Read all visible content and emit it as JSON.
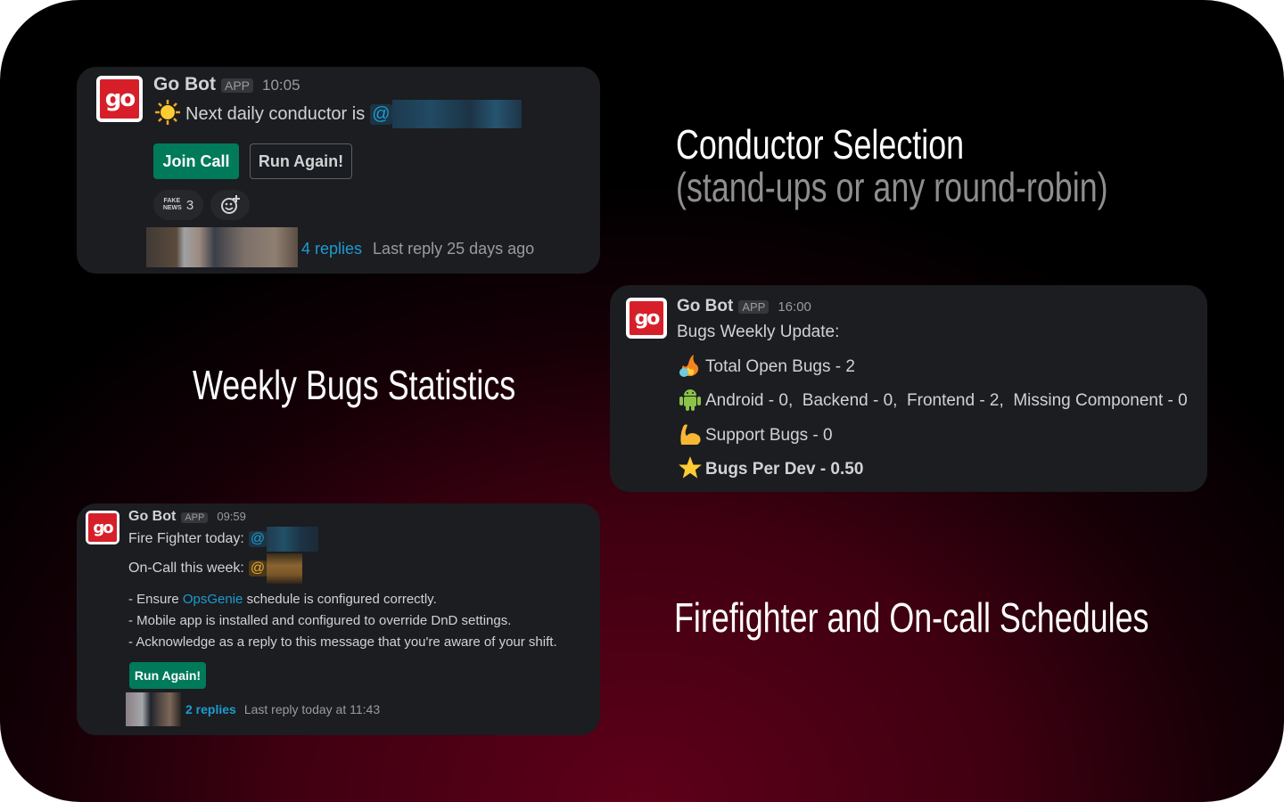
{
  "colors": {
    "accent_green": "#007a5a",
    "link_blue": "#1d9bd1",
    "card_bg": "#1b1d21",
    "brand_red": "#d71f2a"
  },
  "headings": {
    "conductor_title": "Conductor Selection",
    "conductor_subtitle": "(stand-ups or any round-robin)",
    "bugs_title": "Weekly Bugs Statistics",
    "firefighter_title": "Firefighter and On-call Schedules"
  },
  "msg1": {
    "avatar_text": "go",
    "bot_name": "Go Bot",
    "app_badge": "APP",
    "time": "10:05",
    "emoji_icon": "sun-icon",
    "text": "Next daily conductor is",
    "mention": "@",
    "join_call_label": "Join Call",
    "run_again_label": "Run Again!",
    "reaction_emoji": "FAKE NEWS",
    "reaction_count": "3",
    "add_reaction_icon": "add-reaction-icon",
    "replies_label": "4 replies",
    "last_reply": "Last reply 25 days ago"
  },
  "msg2": {
    "avatar_text": "go",
    "bot_name": "Go Bot",
    "app_badge": "APP",
    "time": "16:00",
    "intro": "Bugs Weekly Update:",
    "lines": [
      {
        "icon": "fire-bug-icon",
        "text": "Total Open Bugs - 2"
      },
      {
        "icon": "android-icon",
        "text": "Android - 0,  Backend - 0,  Frontend - 2,  Missing Component - 0"
      },
      {
        "icon": "flexed-biceps-icon",
        "text": "Support Bugs - 0"
      },
      {
        "icon": "star-icon",
        "text": "Bugs Per Dev - 0.50"
      }
    ]
  },
  "msg3": {
    "avatar_text": "go",
    "bot_name": "Go Bot",
    "app_badge": "APP",
    "time": "09:59",
    "firefighter_label": "Fire Fighter today:",
    "oncall_label": "On-Call this week:",
    "mention": "@",
    "bullet1_prefix": "- Ensure ",
    "bullet1_link": "OpsGenie",
    "bullet1_suffix": " schedule is configured correctly.",
    "bullet2": "- Mobile app is installed and configured to override DnD settings.",
    "bullet3": "- Acknowledge as a reply to this message that you're aware of your shift.",
    "run_again_label": "Run Again!",
    "replies_label": "2 replies",
    "last_reply": "Last reply today at 11:43"
  }
}
